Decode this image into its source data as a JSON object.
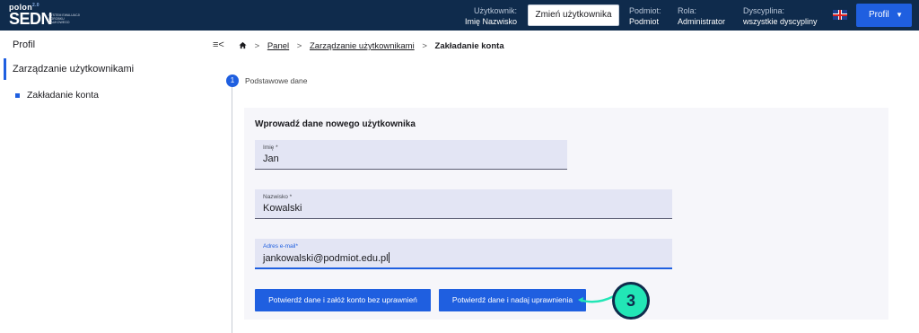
{
  "header": {
    "logo": {
      "top": "polon",
      "sup": "2.0",
      "main": "SEDN",
      "subtitle": "SYSTEM EWALUACJI DOROBKU NAUKOWEGO"
    },
    "user": {
      "label": "Użytkownik:",
      "value": "Imię Nazwisko"
    },
    "change_user_button": "Zmień użytkownika",
    "entity": {
      "label": "Podmiot:",
      "value": "Podmiot"
    },
    "role": {
      "label": "Rola:",
      "value": "Administrator"
    },
    "discipline": {
      "label": "Dyscyplina:",
      "value": "wszystkie dyscypliny"
    },
    "language_flag": "uk-flag-icon",
    "profile_button": "Profil"
  },
  "sidebar": {
    "title": "Profil",
    "active_item": "Zarządzanie użytkownikami",
    "sub_item": "Zakładanie konta",
    "accent": "#1f5fe0"
  },
  "breadcrumb": {
    "items": [
      "Panel",
      "Zarządzanie użytkownikami"
    ],
    "current": "Zakładanie konta",
    "separator": ">"
  },
  "step": {
    "number": "1",
    "label": "Podstawowe dane"
  },
  "form": {
    "title": "Wprowadź dane nowego użytkownika",
    "first_name": {
      "label": "Imię *",
      "value": "Jan"
    },
    "last_name": {
      "label": "Nazwisko *",
      "value": "Kowalski"
    },
    "email": {
      "label": "Adres e-mail*",
      "value": "jankowalski@podmiot.edu.pl"
    },
    "btn_confirm_no_perm": "Potwierdź dane i załóż konto bez uprawnień",
    "btn_confirm_grant": "Potwierdź dane i nadaj uprawnienia"
  },
  "callout": {
    "number": "3",
    "color": "#22e6b6"
  },
  "colors": {
    "header_bg": "#0f2b4c",
    "primary": "#1f5fe0",
    "field_bg": "#e3e5f4",
    "card_bg": "#f6f6fa"
  }
}
